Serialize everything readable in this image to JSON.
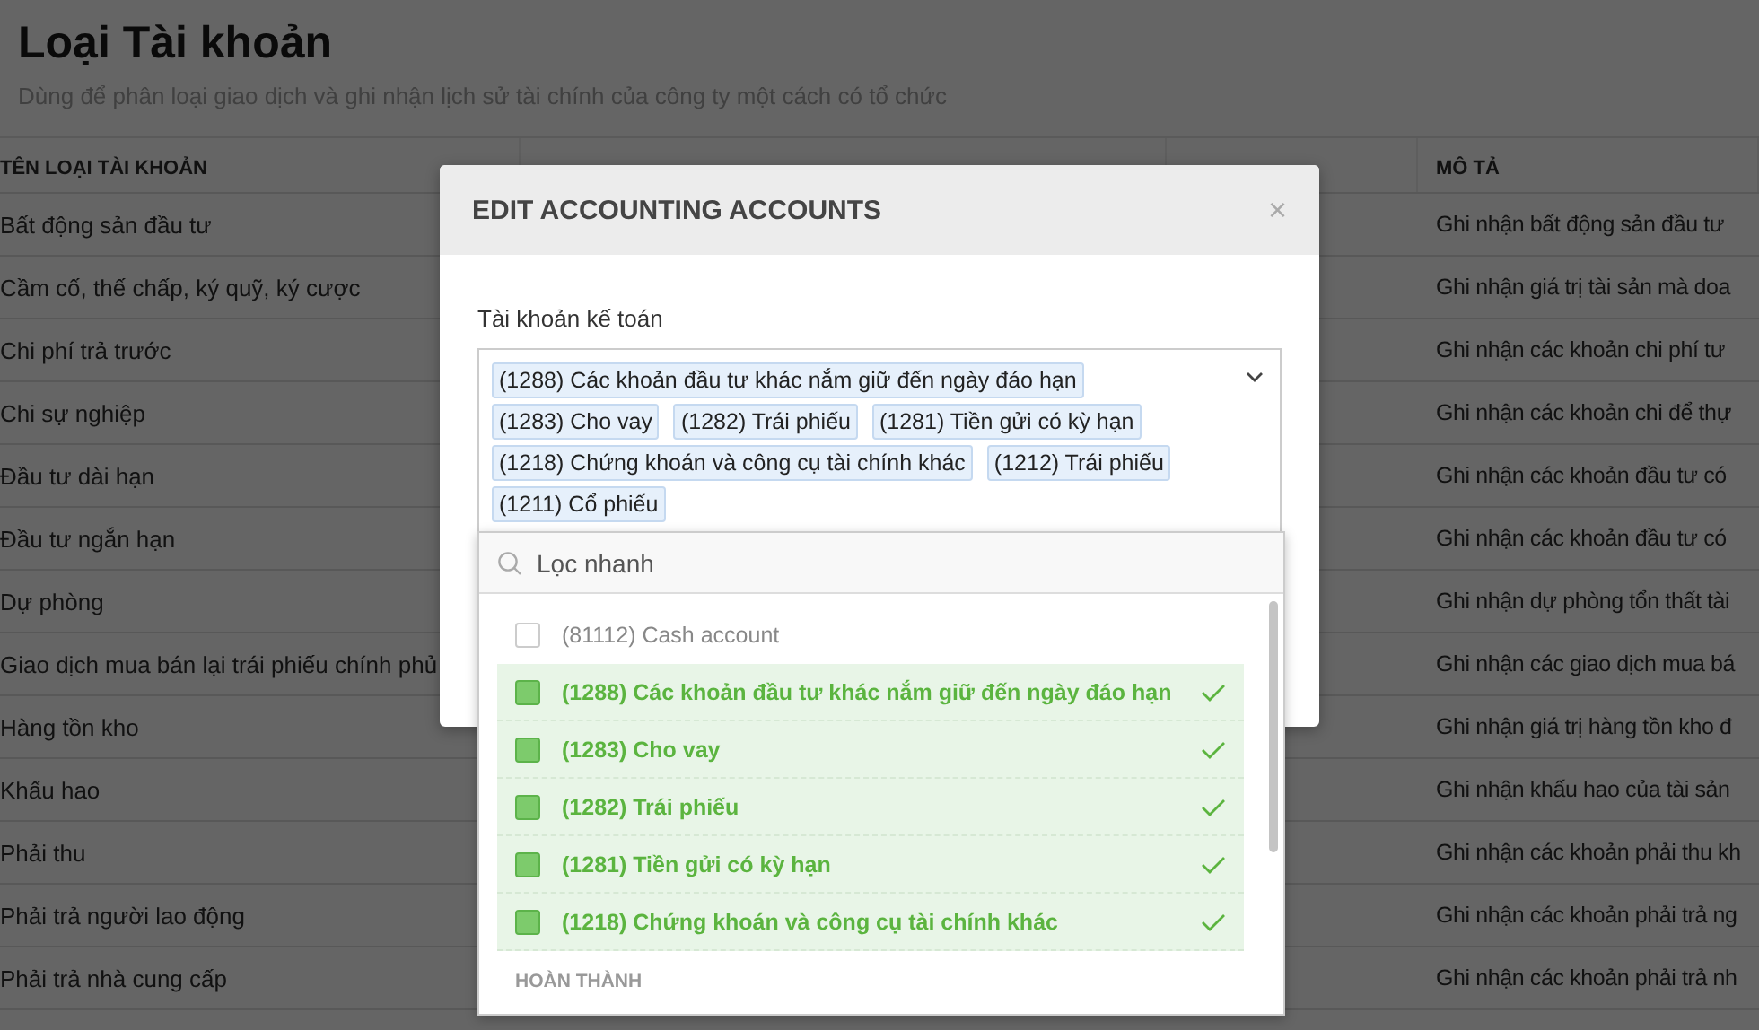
{
  "page": {
    "title": "Loại Tài khoản",
    "subtitle": "Dùng để phân loại giao dịch và ghi nhận lịch sử tài chính của công ty một cách có tổ chức"
  },
  "table": {
    "columns": [
      "TÊN LOẠI TÀI KHOẢN",
      "MÔ TẢ"
    ],
    "rows": [
      {
        "name": "Bất động sản đầu tư",
        "description": "Ghi nhận bất động sản đầu tư"
      },
      {
        "name": "Cầm cố, thế chấp, ký quỹ, ký cược",
        "description": "Ghi nhận giá trị tài sản mà doa"
      },
      {
        "name": "Chi phí trả trước",
        "description": "Ghi nhận các khoản chi phí tư"
      },
      {
        "name": "Chi sự nghiệp",
        "description": "Ghi nhận các khoản chi để thự"
      },
      {
        "name": "Đầu tư dài hạn",
        "description": "Ghi nhận các khoản đầu tư có"
      },
      {
        "name": "Đầu tư ngắn hạn",
        "description": "Ghi nhận các khoản đầu tư có"
      },
      {
        "name": "Dự phòng",
        "description": "Ghi nhận dự phòng tổn thất tài"
      },
      {
        "name": "Giao dịch mua bán lại trái phiếu chính phủ",
        "description": "Ghi nhận các giao dịch mua bá"
      },
      {
        "name": "Hàng tồn kho",
        "description": "Ghi nhận giá trị hàng tồn kho đ"
      },
      {
        "name": "Khấu hao",
        "description": "Ghi nhận khấu hao của tài sản"
      },
      {
        "name": "Phải thu",
        "description": "Ghi nhận các khoản phải thu kh"
      },
      {
        "name": "Phải trả người lao động",
        "description": "Ghi nhận các khoản phải trả ng"
      },
      {
        "name": "Phải trả nhà cung cấp",
        "description": "Ghi nhận các khoản phải trả nh"
      }
    ]
  },
  "modal": {
    "title": "EDIT ACCOUNTING ACCOUNTS",
    "close": "×",
    "field_label": "Tài khoản kế toán",
    "tags": [
      "(1288) Các khoản đầu tư khác nắm giữ đến ngày đáo hạn",
      "(1283) Cho vay",
      "(1282) Trái phiếu",
      "(1281) Tiền gửi có kỳ hạn",
      "(1218) Chứng khoán và công cụ tài chính khác",
      "(1212) Trái phiếu",
      "(1211) Cổ phiếu"
    ],
    "dropdown": {
      "placeholder": "Lọc nhanh",
      "options": [
        {
          "label": "(81112) Cash account",
          "selected": false
        },
        {
          "label": "(1288) Các khoản đầu tư khác nắm giữ đến ngày đáo hạn",
          "selected": true
        },
        {
          "label": "(1283) Cho vay",
          "selected": true
        },
        {
          "label": "(1282) Trái phiếu",
          "selected": true
        },
        {
          "label": "(1281) Tiền gửi có kỳ hạn",
          "selected": true
        },
        {
          "label": "(1218) Chứng khoán và công cụ tài chính khác",
          "selected": true
        }
      ],
      "done": "HOÀN THÀNH"
    }
  }
}
